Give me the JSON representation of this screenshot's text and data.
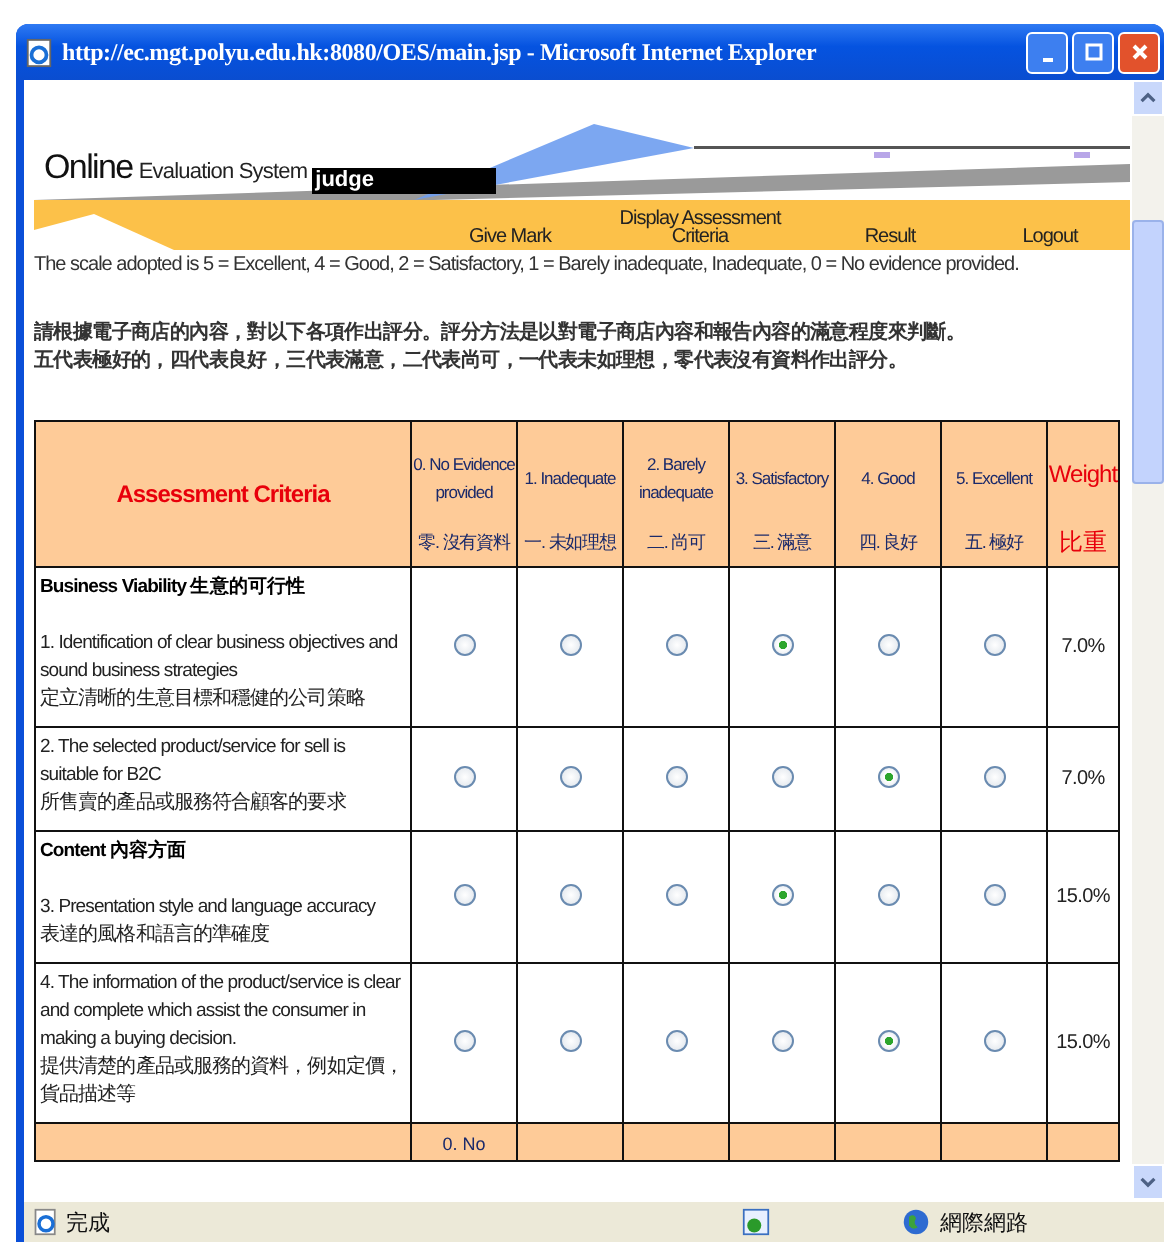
{
  "window": {
    "title": "http://ec.mgt.polyu.edu.hk:8080/OES/main.jsp - Microsoft Internet Explorer"
  },
  "header": {
    "brand_large": "Online",
    "brand_small": "Evaluation System",
    "user": "judge"
  },
  "nav": [
    {
      "label": "Give Mark"
    },
    {
      "label": "Display Assessment Criteria"
    },
    {
      "label": "Result"
    },
    {
      "label": "Logout"
    }
  ],
  "scale_note": "The scale adopted is 5 = Excellent, 4 = Good, 2 = Satisfactory, 1 = Barely inadequate, Inadequate, 0 = No evidence provided.",
  "instructions": [
    "請根據電子商店的內容，對以下各項作出評分。評分方法是以對電子商店內容和報告內容的滿意程度來判斷。",
    "五代表極好的，四代表良好，三代表滿意，二代表尚可，一代表未如理想，零代表沒有資料作出評分。"
  ],
  "table": {
    "criteria_heading": "Assessment Criteria",
    "columns": [
      {
        "en": "0. No Evidence provided",
        "zh": "零. 沒有資料"
      },
      {
        "en": "1. Inadequate",
        "zh": "一. 未如理想"
      },
      {
        "en": "2. Barely inadequate",
        "zh": "二. 尚可"
      },
      {
        "en": "3. Satisfactory",
        "zh": "三. 滿意"
      },
      {
        "en": "4. Good",
        "zh": "四. 良好"
      },
      {
        "en": "5. Excellent",
        "zh": "五. 極好"
      }
    ],
    "weight_heading": {
      "en": "Weight",
      "zh": "比重"
    },
    "rows": [
      {
        "section": "Business Viability 生意的可行性",
        "en": "1. Identification of clear business objectives and sound business strategies",
        "zh": "定立清晰的生意目標和穩健的公司策略",
        "choices": [
          {
            "selected": false
          },
          {
            "selected": false
          },
          {
            "selected": false
          },
          {
            "selected": true
          },
          {
            "selected": false
          },
          {
            "selected": false
          }
        ],
        "weight": "7.0%"
      },
      {
        "en": "2. The selected product/service for sell is suitable for B2C",
        "zh": "所售賣的產品或服務符合顧客的要求",
        "choices": [
          {
            "selected": false
          },
          {
            "selected": false
          },
          {
            "selected": false
          },
          {
            "selected": false
          },
          {
            "selected": true
          },
          {
            "selected": false
          }
        ],
        "weight": "7.0%"
      },
      {
        "section": "Content 內容方面",
        "en": "3. Presentation style and language accuracy",
        "zh": "表達的風格和語言的準確度",
        "choices": [
          {
            "selected": false
          },
          {
            "selected": false
          },
          {
            "selected": false
          },
          {
            "selected": true
          },
          {
            "selected": false
          },
          {
            "selected": false
          }
        ],
        "weight": "15.0%"
      },
      {
        "en": "4. The information of the product/service is clear and complete which assist the consumer in making a buying decision.",
        "zh": "提供清楚的產品或服務的資料，例如定價，貨品描述等",
        "choices": [
          {
            "selected": false
          },
          {
            "selected": false
          },
          {
            "selected": false
          },
          {
            "selected": false
          },
          {
            "selected": true
          },
          {
            "selected": false
          }
        ],
        "weight": "15.0%"
      }
    ],
    "repeat_header_peek": "0. No"
  },
  "status_bar": {
    "text": "完成",
    "zone": "網際網路"
  }
}
